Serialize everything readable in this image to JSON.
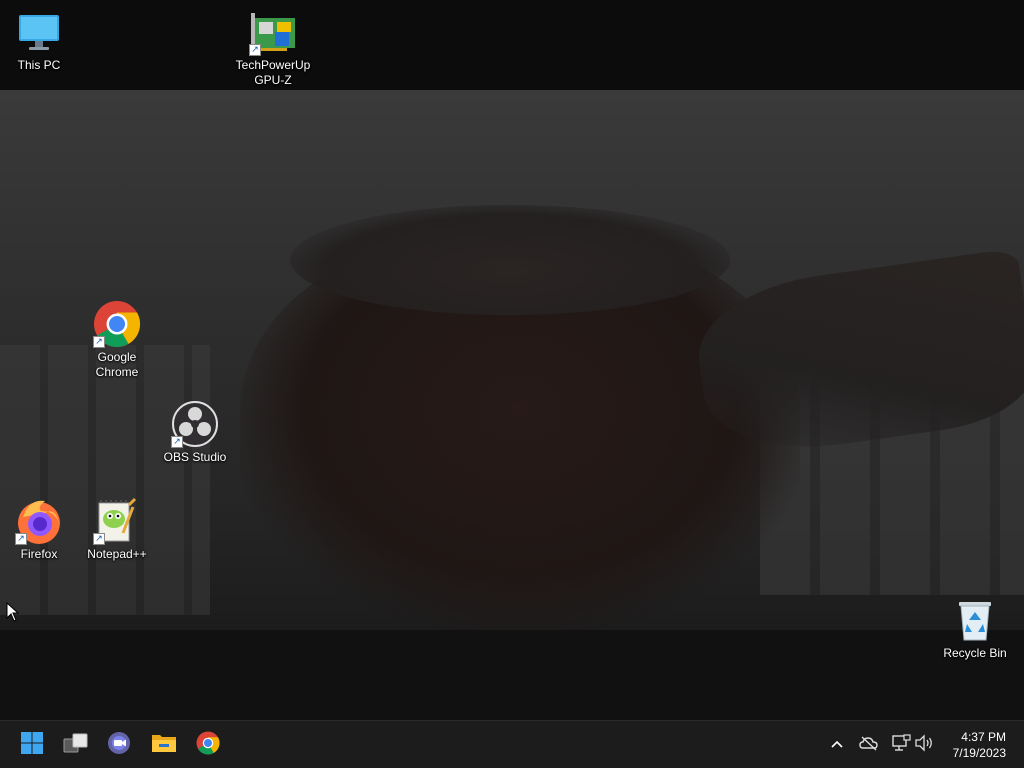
{
  "desktop": {
    "icons": [
      {
        "label": "This PC"
      },
      {
        "label": "TechPowerUp\nGPU-Z"
      },
      {
        "label": "Google\nChrome"
      },
      {
        "label": "OBS Studio"
      },
      {
        "label": "Firefox"
      },
      {
        "label": "Notepad++"
      },
      {
        "label": "Recycle Bin"
      }
    ],
    "icon_names": [
      "this-pc-icon",
      "gpu-z-icon",
      "chrome-icon",
      "obs-studio-icon",
      "firefox-icon",
      "notepad-plus-plus-icon",
      "recycle-bin-icon"
    ]
  },
  "taskbar": {
    "pinned": [
      "start-icon",
      "task-view-icon",
      "teams-chat-icon",
      "file-explorer-icon",
      "chrome-icon"
    ],
    "tray": [
      "chevron-up-icon",
      "onedrive-offline-icon",
      "network-icon",
      "volume-icon"
    ],
    "clock": {
      "time": "4:37 PM",
      "date": "7/19/2023"
    }
  },
  "colors": {
    "taskbar_bg": "#1c1c1c",
    "accent": "#0078d4"
  }
}
